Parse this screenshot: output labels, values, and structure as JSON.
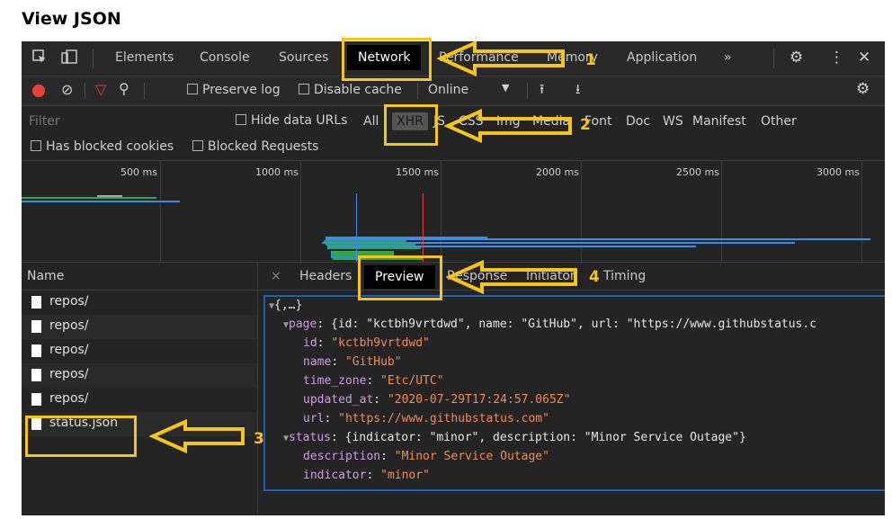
{
  "heading": "View JSON",
  "toolbar": {
    "tabs": [
      "Elements",
      "Console",
      "Sources",
      "Network",
      "Performance",
      "Memory",
      "Application"
    ],
    "overflow": "»"
  },
  "toolbar2": {
    "preserve_log": "Preserve log",
    "disable_cache": "Disable cache",
    "throttle": "Online"
  },
  "filterbar": {
    "filter_placeholder": "Filter",
    "hide_data_urls": "Hide data URLs",
    "types": [
      "All",
      "XHR",
      "JS",
      "CSS",
      "Img",
      "Media",
      "Font",
      "Doc",
      "WS",
      "Manifest",
      "Other"
    ],
    "has_blocked_cookies": "Has blocked cookies",
    "blocked_requests": "Blocked Requests"
  },
  "timeline": {
    "ticks": [
      "500 ms",
      "1000 ms",
      "1500 ms",
      "2000 ms",
      "2500 ms",
      "3000 ms"
    ]
  },
  "requests": {
    "header": "Name",
    "items": [
      "repos/",
      "repos/",
      "repos/",
      "repos/",
      "repos/",
      "status.json"
    ]
  },
  "detail": {
    "close": "×",
    "tabs": [
      "Headers",
      "Preview",
      "Response",
      "Initiator",
      "Timing"
    ]
  },
  "preview": {
    "root": "{,…}",
    "page_key": "page",
    "page_summary": "{id: \"kctbh9vrtdwd\", name: \"GitHub\", url: \"https://www.githubstatus.c",
    "page_fields": [
      {
        "key": "id",
        "value": "\"kctbh9vrtdwd\""
      },
      {
        "key": "name",
        "value": "\"GitHub\""
      },
      {
        "key": "time_zone",
        "value": "\"Etc/UTC\""
      },
      {
        "key": "updated_at",
        "value": "\"2020-07-29T17:24:57.065Z\""
      },
      {
        "key": "url",
        "value": "\"https://www.githubstatus.com\""
      }
    ],
    "status_key": "status",
    "status_summary": "{indicator: \"minor\", description: \"Minor Service Outage\"}",
    "status_fields": [
      {
        "key": "description",
        "value": "\"Minor Service Outage\""
      },
      {
        "key": "indicator",
        "value": "\"minor\""
      }
    ]
  },
  "annotations": {
    "numbers": [
      "1",
      "2",
      "3",
      "4"
    ],
    "color": "#f5c518"
  },
  "colors": {
    "devtools_bg": "#242424",
    "json_key": "#d09ae6",
    "json_string": "#f28b54",
    "record_red": "#e8413c"
  }
}
